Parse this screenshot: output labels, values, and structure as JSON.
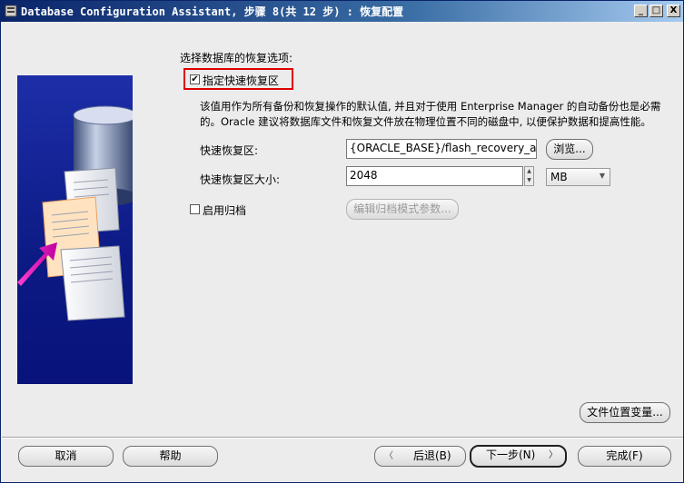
{
  "window": {
    "title": "Database Configuration Assistant, 步骤 8(共 12 步) : 恢复配置",
    "minimize_glyph": "_",
    "maximize_glyph": "□",
    "close_glyph": "X"
  },
  "section": {
    "heading": "选择数据库的恢复选项:"
  },
  "fast_recovery": {
    "checkbox_label": "指定快速恢复区",
    "checked": true,
    "description_line1": "该值用作为所有备份和恢复操作的默认值, 并且对于使用 Enterprise Manager 的自动备份也是必需",
    "description_line2": "的。Oracle 建议将数据库文件和恢复文件放在物理位置不同的磁盘中, 以便保护数据和提高性能。",
    "area_label": "快速恢复区:",
    "area_value": "{ORACLE_BASE}/flash_recovery_area",
    "browse_label": "浏览...",
    "size_label": "快速恢复区大小:",
    "size_value": "2048",
    "unit_value": "MB"
  },
  "archive": {
    "checkbox_label": "启用归档",
    "checked": false,
    "edit_params_label": "编辑归档模式参数..."
  },
  "file_location_vars_label": "文件位置变量...",
  "footer": {
    "cancel": "取消",
    "help": "帮助",
    "back": "后退(B)",
    "next": "下一步(N)",
    "finish": "完成(F)"
  },
  "colors": {
    "highlight": "#e00000",
    "title_bar": "#0a246a",
    "art_background": "#0c1a84"
  }
}
